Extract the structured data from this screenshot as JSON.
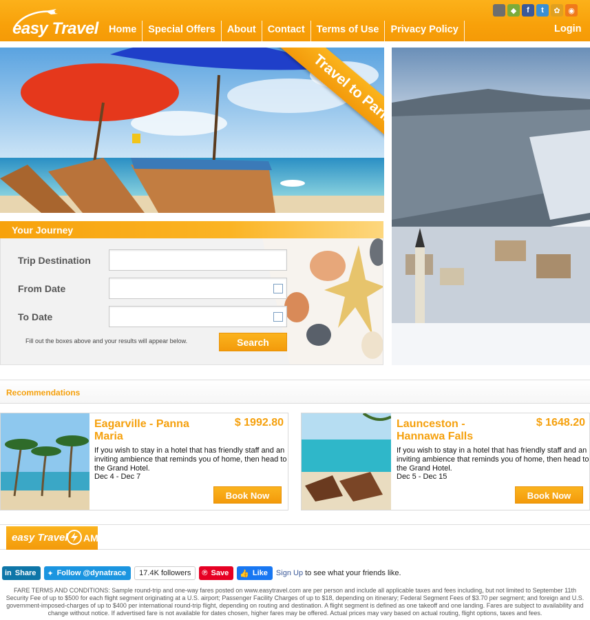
{
  "brand": {
    "logo_text": "easy Travel"
  },
  "nav": {
    "items": [
      "Home",
      "Special Offers",
      "About",
      "Contact",
      "Terms of Use",
      "Privacy Policy"
    ],
    "login": "Login"
  },
  "social": [
    "apple-icon",
    "android-icon",
    "facebook-icon",
    "twitter-icon",
    "widget-icon",
    "rss-icon"
  ],
  "hero": {
    "ribbon": "Travel to Paris"
  },
  "journey": {
    "title": "Your Journey",
    "destination_label": "Trip Destination",
    "from_label": "From Date",
    "to_label": "To Date",
    "destination_value": "",
    "from_value": "",
    "to_value": "",
    "hint": "Fill out the boxes above and your results will appear below.",
    "search": "Search"
  },
  "recommendations": {
    "title": "Recommendations",
    "cards": [
      {
        "title": "Eagarville - Panna Maria",
        "price": "$ 1992.80",
        "desc": "If you wish to stay in a hotel that has friendly staff and an inviting ambience that reminds you of home, then head to the Grand Hotel.",
        "dates": "Dec 4 - Dec 7",
        "button": "Book Now"
      },
      {
        "title": "Launceston - Hannawa Falls",
        "price": "$ 1648.20",
        "desc": "If you wish to stay in a hotel that has friendly staff and an inviting ambience that reminds you of home, then head to the Grand Hotel.",
        "dates": "Dec 5 - Dec 15",
        "button": "Book Now"
      }
    ]
  },
  "amp": {
    "logo_text": "easy Travel",
    "amp": "AMP"
  },
  "share": {
    "linkedin": "Share",
    "twitter": "Follow @dynatrace",
    "followers": "17.4K followers",
    "pinterest": "Save",
    "facebook": "Like",
    "signup_link": "Sign Up",
    "signup_rest": " to see what your friends like."
  },
  "fare_terms": "FARE TERMS AND CONDITIONS: Sample round-trip and one-way fares posted on www.easytravel.com are per person and include all applicable taxes and fees including, but not limited to September 11th Security Fee of up to $500 for each flight segment originating at a U.S. airport; Passenger Facility Charges of up to $18, depending on itinerary; Federal Segment Fees of $3.70 per segment; and foreign and U.S. government-imposed-charges of up to $400 per international round-trip flight, depending on routing and destination. A flight segment is defined as one takeoff and one landing. Fares are subject to availability and change without notice. If advertised fare is not available for dates chosen, higher fares may be offered. Actual prices may vary based on actual routing, flight options, taxes and fees.",
  "colors": {
    "accent": "#f8a10a",
    "title_orange": "#f5a00c"
  }
}
